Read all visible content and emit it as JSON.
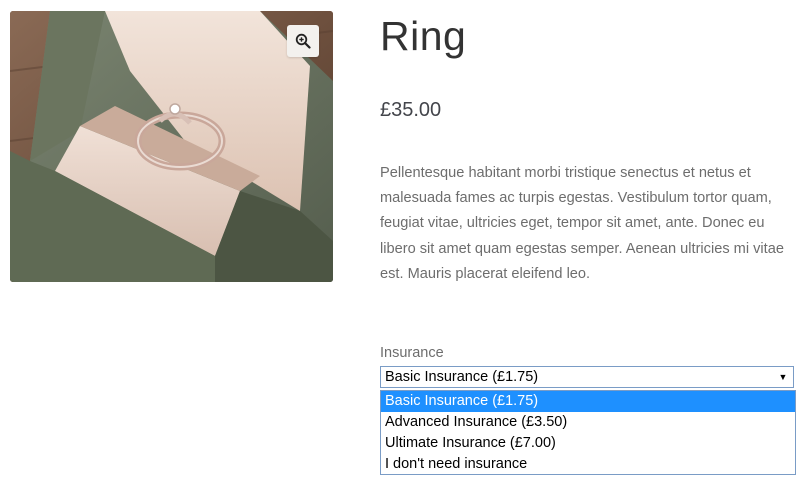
{
  "product": {
    "title": "Ring",
    "price": "£35.00",
    "description": "Pellentesque habitant morbi tristique senectus et netus et malesuada fames ac turpis egestas. Vestibulum tortor quam, feugiat vitae, ultricies eget, tempor sit amet, ante. Donec eu libero sit amet quam egestas semper. Aenean ultricies mi vitae est. Mauris placerat eleifend leo."
  },
  "gallery": {
    "zoom_icon": "zoom-in-icon"
  },
  "insurance": {
    "label": "Insurance",
    "selected_value": "Basic Insurance (£1.75)",
    "options": [
      {
        "label": "Basic Insurance (£1.75)",
        "selected": true
      },
      {
        "label": "Advanced Insurance (£3.50)",
        "selected": false
      },
      {
        "label": "Ultimate Insurance (£7.00)",
        "selected": false
      },
      {
        "label": "I don't need insurance",
        "selected": false
      }
    ]
  },
  "colors": {
    "highlight": "#1e90ff",
    "select_border": "#7a9cc6",
    "body_text": "#6d6d6d",
    "title_text": "#333333"
  }
}
